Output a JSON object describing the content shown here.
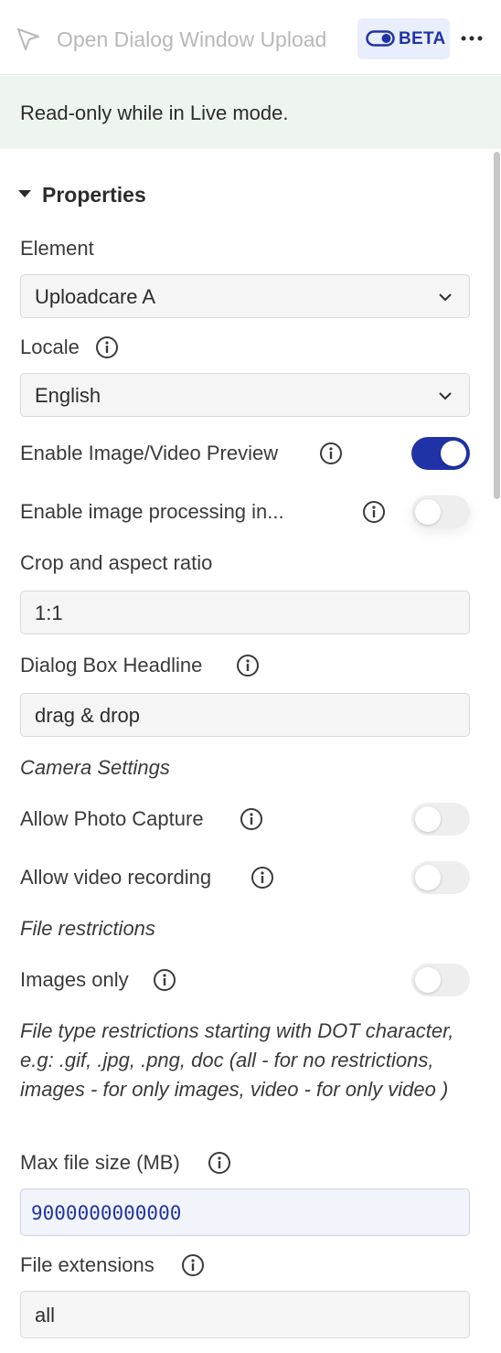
{
  "header": {
    "title": "Open Dialog Window Upload",
    "beta_label": "BETA",
    "icons": {
      "cursor": "cursor-pointer-icon",
      "toggle": "toggle-icon",
      "more": "more-options-icon"
    }
  },
  "banner": {
    "text": "Read-only while in Live mode."
  },
  "properties": {
    "section_title": "Properties",
    "element": {
      "label": "Element",
      "value": "Uploadcare A"
    },
    "locale": {
      "label": "Locale",
      "value": "English"
    },
    "enable_preview": {
      "label": "Enable Image/Video Preview",
      "on": true
    },
    "enable_processing": {
      "label": "Enable image processing in...",
      "on": false
    },
    "crop": {
      "label": "Crop and aspect ratio",
      "value": "1:1"
    },
    "headline": {
      "label": "Dialog Box Headline",
      "value": "drag & drop"
    },
    "camera_settings_heading": "Camera Settings",
    "allow_photo": {
      "label": "Allow Photo Capture",
      "on": false
    },
    "allow_video": {
      "label": "Allow video recording",
      "on": false
    },
    "file_restrictions_heading": "File restrictions",
    "images_only": {
      "label": "Images only",
      "on": false
    },
    "file_type_help": "File type restrictions starting with DOT character, e.g: .gif, .jpg, .png, doc (all - for no restrictions, images - for only images, video - for only video )",
    "max_file_size": {
      "label": "Max file size (MB)",
      "value": "9000000000000"
    },
    "file_extensions": {
      "label": "File extensions",
      "value": "all"
    }
  },
  "colors": {
    "accent": "#1f33a6",
    "banner_bg": "#eef5ef",
    "beta_bg": "#e9eefc"
  }
}
